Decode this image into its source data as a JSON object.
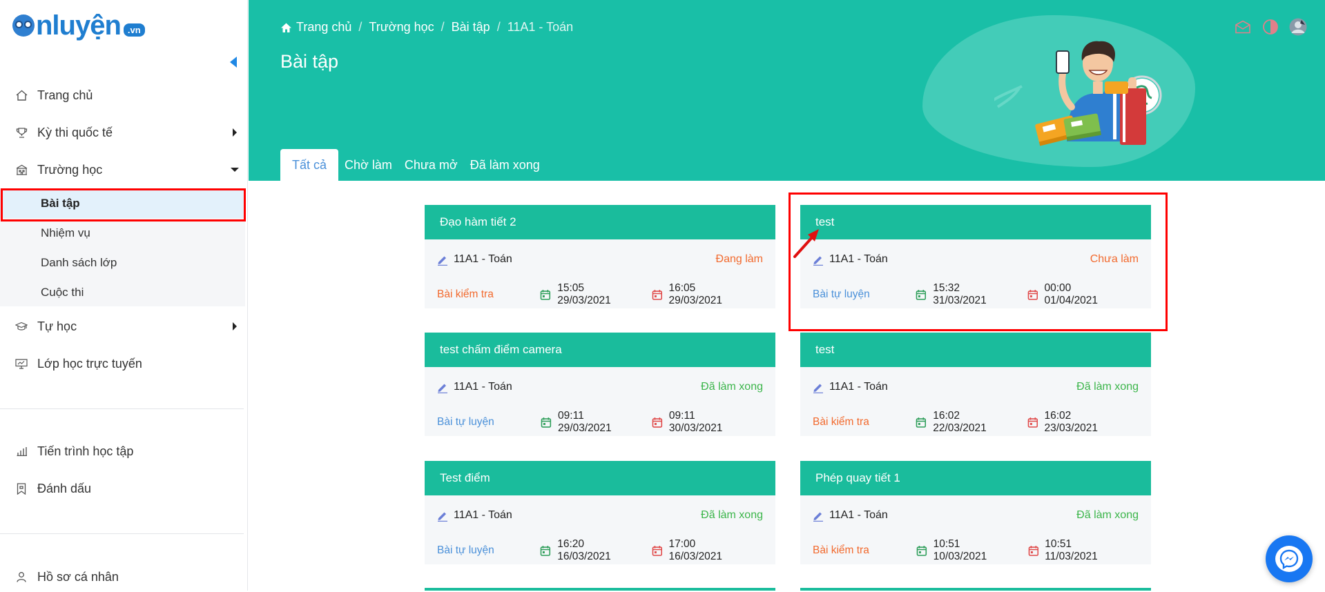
{
  "logo": {
    "text_main": "nluyện",
    "text_vn": ".vn"
  },
  "sidebar": {
    "items": [
      {
        "label": "Trang chủ",
        "icon": "home-icon"
      },
      {
        "label": "Kỳ thi quốc tế",
        "icon": "trophy-icon"
      },
      {
        "label": "Trường học",
        "icon": "school-icon"
      }
    ],
    "sub_items": [
      {
        "label": "Bài tập"
      },
      {
        "label": "Nhiệm vụ"
      },
      {
        "label": "Danh sách lớp"
      },
      {
        "label": "Cuộc thi"
      }
    ],
    "items2": [
      {
        "label": "Tự học",
        "icon": "graduation-cap-icon"
      },
      {
        "label": "Lớp học trực tuyến",
        "icon": "monitor-icon"
      }
    ],
    "items3": [
      {
        "label": "Tiến trình học tập",
        "icon": "chart-icon"
      },
      {
        "label": "Đánh dấu",
        "icon": "bookmark-icon"
      }
    ],
    "items4": [
      {
        "label": "Hồ sơ cá nhân",
        "icon": "user-icon"
      }
    ]
  },
  "header": {
    "breadcrumb": [
      "Trang chủ",
      "Trường học",
      "Bài tập",
      "11A1 - Toán"
    ],
    "title": "Bài tập",
    "tabs": [
      "Tất cả",
      "Chờ làm",
      "Chưa mở",
      "Đã làm xong"
    ]
  },
  "cards": [
    {
      "title": "Đạo hàm tiết 2",
      "class": "11A1 - Toán",
      "status": "Đang làm",
      "status_color": "#f26a2e",
      "kind": "Bài kiểm tra",
      "kind_color": "#f26a2e",
      "start": "15:05 29/03/2021",
      "end": "16:05 29/03/2021"
    },
    {
      "title": "test",
      "class": "11A1 - Toán",
      "status": "Chưa làm",
      "status_color": "#f26a2e",
      "kind": "Bài tự luyện",
      "kind_color": "#4a90d9",
      "start": "15:32 31/03/2021",
      "end": "00:00 01/04/2021"
    },
    {
      "title": "test chấm điểm camera",
      "class": "11A1 - Toán",
      "status": "Đã làm xong",
      "status_color": "#3bb54a",
      "kind": "Bài tự luyện",
      "kind_color": "#4a90d9",
      "start": "09:11 29/03/2021",
      "end": "09:11 30/03/2021"
    },
    {
      "title": "test",
      "class": "11A1 - Toán",
      "status": "Đã làm xong",
      "status_color": "#3bb54a",
      "kind": "Bài kiểm tra",
      "kind_color": "#f26a2e",
      "start": "16:02 22/03/2021",
      "end": "16:02 23/03/2021"
    },
    {
      "title": "Test điểm",
      "class": "11A1 - Toán",
      "status": "Đã làm xong",
      "status_color": "#3bb54a",
      "kind": "Bài tự luyện",
      "kind_color": "#4a90d9",
      "start": "16:20 16/03/2021",
      "end": "17:00 16/03/2021"
    },
    {
      "title": "Phép quay tiết 1",
      "class": "11A1 - Toán",
      "status": "Đã làm xong",
      "status_color": "#3bb54a",
      "kind": "Bài kiểm tra",
      "kind_color": "#f26a2e",
      "start": "10:51 10/03/2021",
      "end": "10:51 11/03/2021"
    }
  ],
  "colors": {
    "accent": "#19bfa7",
    "card_header": "#1abc9c",
    "highlight": "#ff0000"
  }
}
